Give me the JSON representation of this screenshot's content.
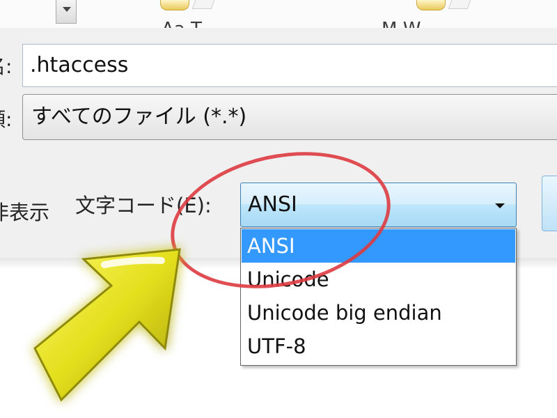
{
  "dialog": {
    "filename_label": "名:",
    "filename_value": ".htaccess",
    "filetype_label": "類:",
    "filetype_value": "すべてのファイル (*.*)",
    "hide_extension_label": "非表示",
    "encoding_label": "文字コード(E):",
    "encoding_value": "ANSI",
    "encoding_options": [
      "ANSI",
      "Unicode",
      "Unicode big endian",
      "UTF-8"
    ],
    "encoding_selected_index": 0
  },
  "top_strip": {
    "cut_text_left": "Aa T",
    "cut_text_right": "M  W"
  },
  "colors": {
    "highlight": "#3399ff",
    "ellipse": "#dd3b40",
    "arrow": "#e4df1c"
  },
  "icons": [
    "chevron-down-icon",
    "folder-icon",
    "document-icon",
    "pointer-arrow-icon"
  ]
}
